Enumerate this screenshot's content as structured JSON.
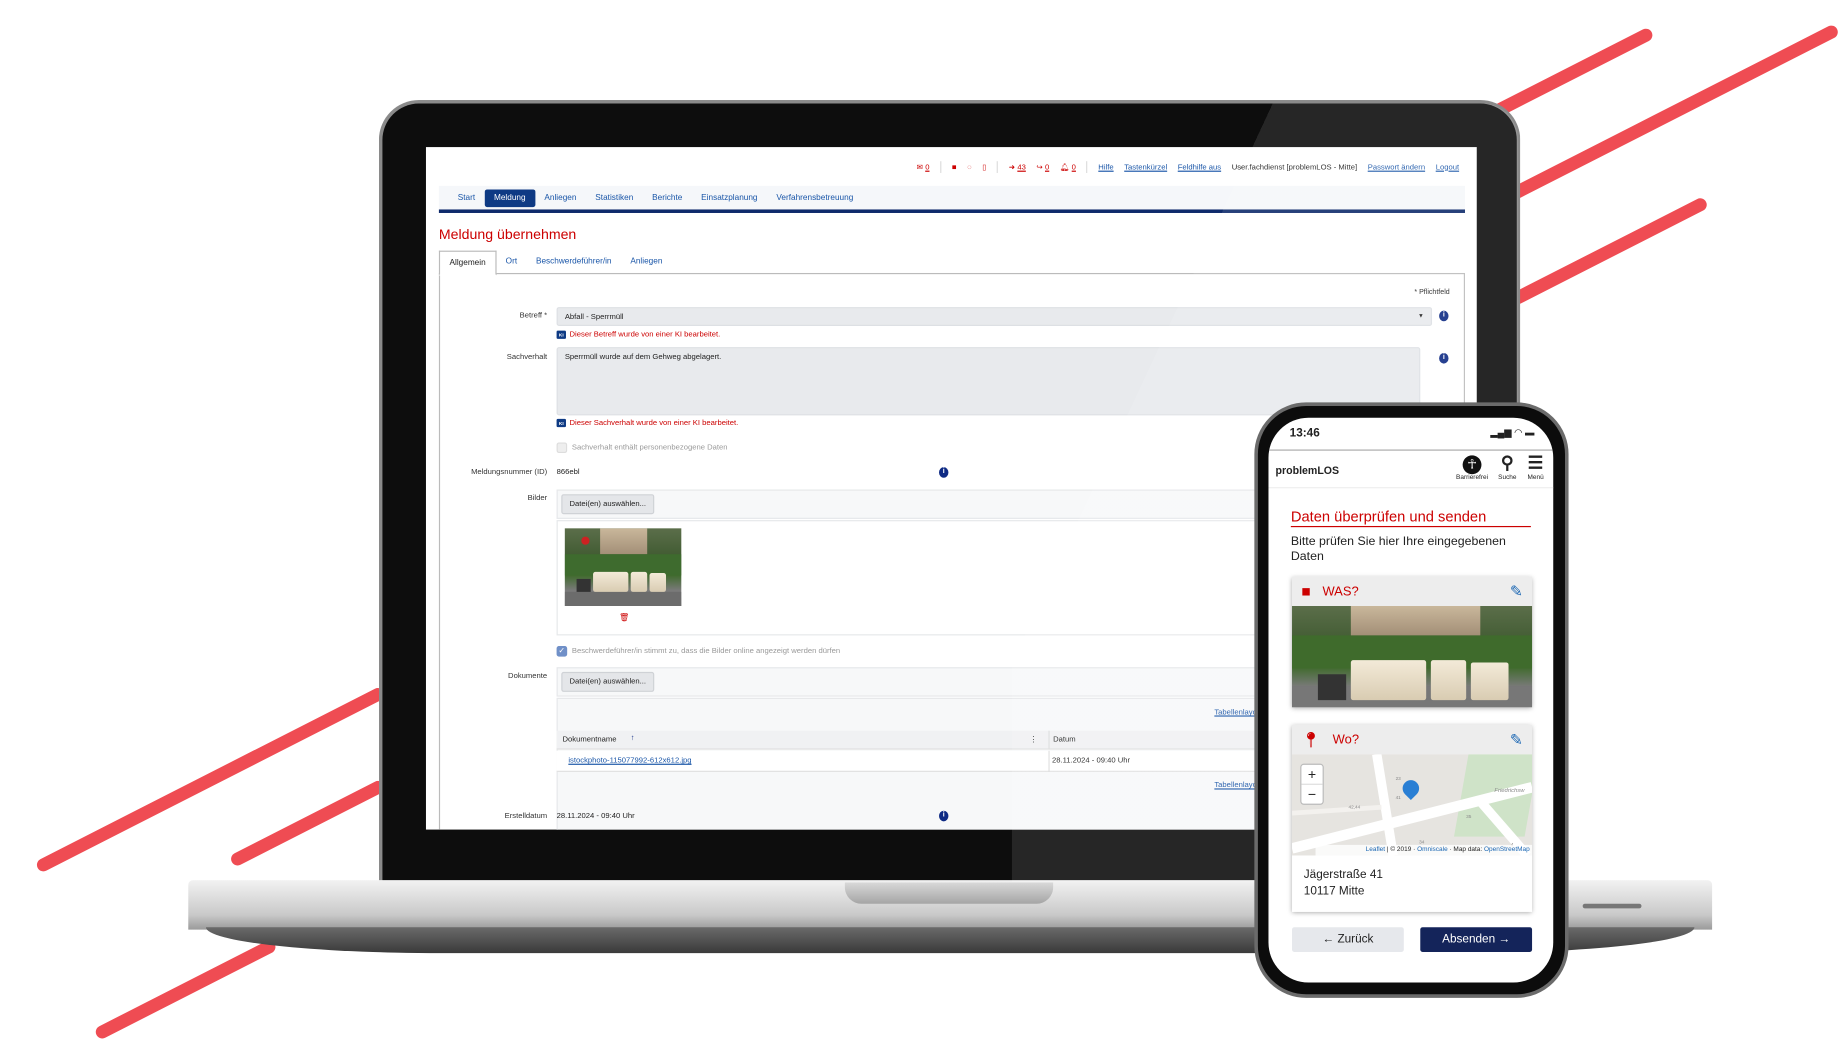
{
  "colors": {
    "accent_red": "#c00000",
    "brand_blue": "#0e2a6b",
    "stripe_red": "#ef4c53"
  },
  "desktop": {
    "topbar": {
      "mail_count": "0",
      "login_count": "43",
      "forward_count": "0",
      "bell_count": "0",
      "links": [
        "Hilfe",
        "Tastenkürzel",
        "Feldhilfe aus"
      ],
      "user": "User.fachdienst [problemLOS - Mitte]",
      "password_link": "Passwort ändern",
      "logout": "Logout",
      "icons": [
        "mail-icon",
        "folder-icon",
        "comment-icon",
        "document-icon",
        "sign-in-icon",
        "share-icon",
        "bell-icon"
      ]
    },
    "nav": [
      "Start",
      "Meldung",
      "Anliegen",
      "Statistiken",
      "Berichte",
      "Einsatzplanung",
      "Verfahrensbetreuung"
    ],
    "nav_active": "Meldung",
    "title": "Meldung übernehmen",
    "tabs": [
      "Allgemein",
      "Ort",
      "Beschwerdeführer/in",
      "Anliegen"
    ],
    "required_note": "* Pflichtfeld",
    "form": {
      "betreff_label": "Betreff *",
      "betreff_value": "Abfall - Sperrmüll",
      "betreff_ki": "Dieser Betreff wurde von einer KI bearbeitet.",
      "sachverhalt_label": "Sachverhalt",
      "sachverhalt_value": "Sperrmüll wurde auf dem Gehweg abgelagert.",
      "sachverhalt_ki": "Dieser Sachverhalt wurde von einer KI bearbeitet.",
      "ki_badge": "KI",
      "personal_data_checkbox": "Sachverhalt enthält personenbezogene Daten",
      "id_label": "Meldungsnummer (ID)",
      "id_value": "866ebl",
      "bilder_label": "Bilder",
      "choose_files": "Datei(en) auswählen...",
      "consent_checkbox": "Beschwerdeführer/in stimmt zu, dass die Bilder online angezeigt werden dürfen",
      "dokumente_label": "Dokumente",
      "table_layout_link": "Tabellenlayout",
      "table": {
        "columns": [
          "Dokumentname",
          "Datum"
        ],
        "rows": [
          [
            "istockphoto-115077992-612x612.jpg",
            "28.11.2024 - 09:40 Uhr"
          ]
        ]
      },
      "erstelldatum_label": "Erstelldatum",
      "erstelldatum_value": "28.11.2024 - 09:40 Uhr"
    }
  },
  "phone": {
    "time": "13:46",
    "brand": "problemLOS",
    "header_icons": [
      {
        "icon": "accessibility-icon",
        "label": "Barrierefrei"
      },
      {
        "icon": "search-icon",
        "label": "Suche"
      },
      {
        "icon": "menu-icon",
        "label": "Menü"
      }
    ],
    "title": "Daten überprüfen und senden",
    "subtitle": "Bitte prüfen Sie hier Ihre eingegebenen Daten",
    "was_title": "WAS?",
    "wo_title": "Wo?",
    "map": {
      "zoom_in": "+",
      "zoom_out": "−",
      "attribution_leaflet": "Leaflet",
      "attribution_mid": "| © 2019 ·",
      "attribution_omniscale": "Omniscale",
      "attribution_data": "· Map data:",
      "attribution_osm": "OpenStreetMap",
      "labels": [
        "23",
        "41",
        "42,44",
        "35",
        "34",
        "4",
        "Friedrichsw"
      ]
    },
    "address_line1": "Jägerstraße 41",
    "address_line2": "10117 Mitte",
    "back_button": "← Zurück",
    "submit_button": "Absenden →"
  }
}
